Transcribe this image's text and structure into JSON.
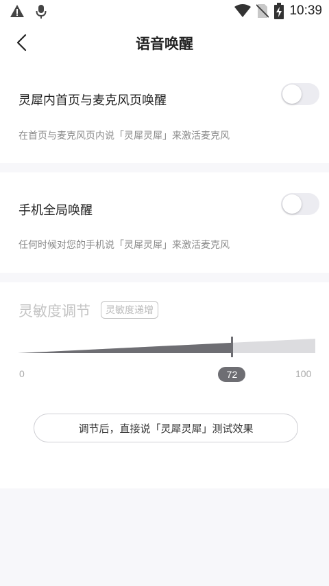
{
  "status_bar": {
    "time": "10:39",
    "icons": [
      "warning-icon",
      "mic-icon",
      "wifi-icon",
      "no-sim-icon",
      "battery-charging-icon"
    ]
  },
  "header": {
    "title": "语音唤醒",
    "back_icon": "chevron-left-icon"
  },
  "settings": [
    {
      "title": "灵犀内首页与麦克风页唤醒",
      "description": "在首页与麦克风页内说「灵犀灵犀」来激活麦克风",
      "enabled": false
    },
    {
      "title": "手机全局唤醒",
      "description": "任何时候对您的手机说「灵犀灵犀」来激活麦克风",
      "enabled": false
    }
  ],
  "sensitivity": {
    "title": "灵敏度调节",
    "badge": "灵敏度递增",
    "min_label": "0",
    "max_label": "100",
    "value": 72,
    "value_label": "72",
    "test_button": "调节后，直接说「灵犀灵犀」测试效果"
  },
  "colors": {
    "accent_dark": "#6e6e73",
    "track_light": "#dcdcdf",
    "disabled_text": "#c4c4c4"
  }
}
